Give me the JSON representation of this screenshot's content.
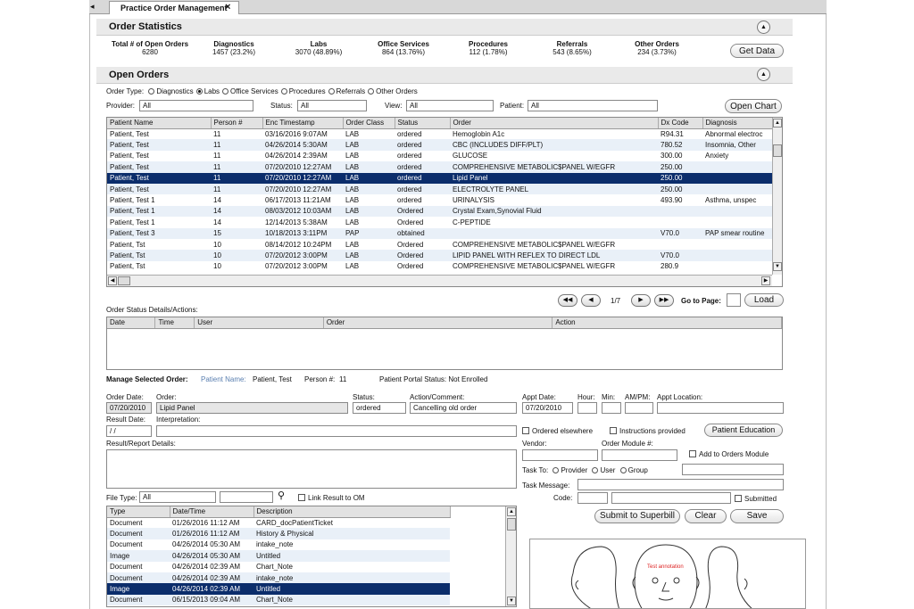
{
  "tab": {
    "title": "Practice Order Management",
    "close": "×"
  },
  "order_stats": {
    "title": "Order Statistics",
    "get_data": "Get Data",
    "items": [
      {
        "label": "Total # of Open Orders",
        "value": "6280"
      },
      {
        "label": "Diagnostics",
        "value": "1457 (23.2%)"
      },
      {
        "label": "Labs",
        "value": "3070 (48.89%)"
      },
      {
        "label": "Office Services",
        "value": "864 (13.76%)"
      },
      {
        "label": "Procedures",
        "value": "112 (1.78%)"
      },
      {
        "label": "Referrals",
        "value": "543 (8.65%)"
      },
      {
        "label": "Other Orders",
        "value": "234 (3.73%)"
      }
    ]
  },
  "open_orders": {
    "title": "Open Orders",
    "order_type_label": "Order Type:",
    "order_types": [
      "Diagnostics",
      "Labs",
      "Office Services",
      "Procedures",
      "Referrals",
      "Other Orders"
    ],
    "selected_type": "Labs",
    "provider_label": "Provider:",
    "provider_value": "All",
    "status_label": "Status:",
    "status_value": "All",
    "view_label": "View:",
    "view_value": "All",
    "patient_label": "Patient:",
    "patient_value": "All",
    "open_chart": "Open Chart",
    "columns": [
      "Patient Name",
      "Person #",
      "Enc Timestamp",
      "Order Class",
      "Status",
      "Order",
      "Dx Code",
      "Diagnosis"
    ],
    "rows": [
      [
        "Patient, Test",
        "11",
        "03/16/2016 9:07AM",
        "LAB",
        "ordered",
        "Hemoglobin A1c",
        "R94.31",
        "Abnormal electroc"
      ],
      [
        "Patient, Test",
        "11",
        "04/26/2014 5:30AM",
        "LAB",
        "ordered",
        "CBC (INCLUDES DIFF/PLT)",
        "780.52",
        "Insomnia, Other"
      ],
      [
        "Patient, Test",
        "11",
        "04/26/2014 2:39AM",
        "LAB",
        "ordered",
        "GLUCOSE",
        "300.00",
        "Anxiety"
      ],
      [
        "Patient, Test",
        "11",
        "07/20/2010 12:27AM",
        "LAB",
        "ordered",
        "COMPREHENSIVE METABOLIC$PANEL W/EGFR",
        "250.00",
        ""
      ],
      [
        "Patient, Test",
        "11",
        "07/20/2010 12:27AM",
        "LAB",
        "ordered",
        "Lipid Panel",
        "250.00",
        ""
      ],
      [
        "Patient, Test",
        "11",
        "07/20/2010 12:27AM",
        "LAB",
        "ordered",
        "ELECTROLYTE PANEL",
        "250.00",
        ""
      ],
      [
        "Patient, Test 1",
        "14",
        "06/17/2013 11:21AM",
        "LAB",
        "ordered",
        "URINALYSIS",
        "493.90",
        "Asthma, unspec"
      ],
      [
        "Patient, Test 1",
        "14",
        "08/03/2012 10:03AM",
        "LAB",
        "Ordered",
        "Crystal Exam,Synovial Fluid",
        "",
        ""
      ],
      [
        "Patient, Test 1",
        "14",
        "12/14/2013 5:38AM",
        "LAB",
        "Ordered",
        "C-PEPTIDE",
        "",
        ""
      ],
      [
        "Patient, Test 3",
        "15",
        "10/18/2013 3:11PM",
        "PAP",
        "obtained",
        "",
        "V70.0",
        "PAP smear routine"
      ],
      [
        "Patient, Tst",
        "10",
        "08/14/2012 10:24PM",
        "LAB",
        "Ordered",
        "COMPREHENSIVE METABOLIC$PANEL W/EGFR",
        "",
        ""
      ],
      [
        "Patient, Tst",
        "10",
        "07/20/2012 3:00PM",
        "LAB",
        "Ordered",
        "LIPID PANEL WITH REFLEX TO DIRECT LDL",
        "V70.0",
        ""
      ],
      [
        "Patient, Tst",
        "10",
        "07/20/2012 3:00PM",
        "LAB",
        "Ordered",
        "COMPREHENSIVE METABOLIC$PANEL W/EGFR",
        "280.9",
        ""
      ]
    ],
    "selected_row": 4
  },
  "pager": {
    "page": "1/7",
    "goto_label": "Go to Page:",
    "load": "Load"
  },
  "status_details": {
    "label": "Order Status Details/Actions:",
    "columns": [
      "Date",
      "Time",
      "User",
      "Order",
      "Action"
    ]
  },
  "manage": {
    "label": "Manage Selected Order:",
    "patient_name_label": "Patient Name:",
    "patient_name": "Patient, Test",
    "person_label": "Person #:",
    "person": "11",
    "portal": "Patient Portal Status: Not Enrolled",
    "order_date_label": "Order Date:",
    "order_date": "07/20/2010",
    "order_label": "Order:",
    "order": "Lipid Panel",
    "status_label": "Status:",
    "status": "ordered",
    "action_label": "Action/Comment:",
    "action": "Cancelling old order",
    "appt_date_label": "Appt Date:",
    "appt_date": "07/20/2010",
    "hour_label": "Hour:",
    "min_label": "Min:",
    "ampm_label": "AM/PM:",
    "appt_loc_label": "Appt Location:",
    "result_date_label": "Result Date:",
    "result_date": " / /",
    "interp_label": "Interpretation:",
    "ordered_elsewhere": "Ordered elsewhere",
    "instructions": "Instructions provided",
    "patient_education": "Patient Education",
    "result_details_label": "Result/Report Details:",
    "vendor_label": "Vendor:",
    "order_module_label": "Order Module #:",
    "add_to_orders": "Add to Orders Module",
    "task_to_label": "Task To:",
    "task_options": [
      "Provider",
      "User",
      "Group"
    ],
    "task_message_label": "Task Message:",
    "code_label": "Code:",
    "submitted": "Submitted",
    "submit": "Submit to Superbill",
    "clear": "Clear",
    "save": "Save"
  },
  "files": {
    "file_type_label": "File Type:",
    "file_type": "All",
    "link_label": "Link Result to OM",
    "columns": [
      "Type",
      "Date/Time",
      "Description"
    ],
    "rows": [
      [
        "Document",
        "01/26/2016 11:12 AM",
        "CARD_docPatientTicket"
      ],
      [
        "Document",
        "01/26/2016 11:12 AM",
        "History & Physical"
      ],
      [
        "Document",
        "04/26/2014 05:30 AM",
        "intake_note"
      ],
      [
        "Image",
        "04/26/2014 05:30 AM",
        "Untitled"
      ],
      [
        "Document",
        "04/26/2014 02:39 AM",
        "Chart_Note"
      ],
      [
        "Document",
        "04/26/2014 02:39 AM",
        "intake_note"
      ],
      [
        "Image",
        "04/26/2014 02:39 AM",
        "Untitled"
      ],
      [
        "Document",
        "06/15/2013 09:04 AM",
        "Chart_Note"
      ]
    ],
    "selected_row": 6
  },
  "image_annotation": "Test annotation"
}
